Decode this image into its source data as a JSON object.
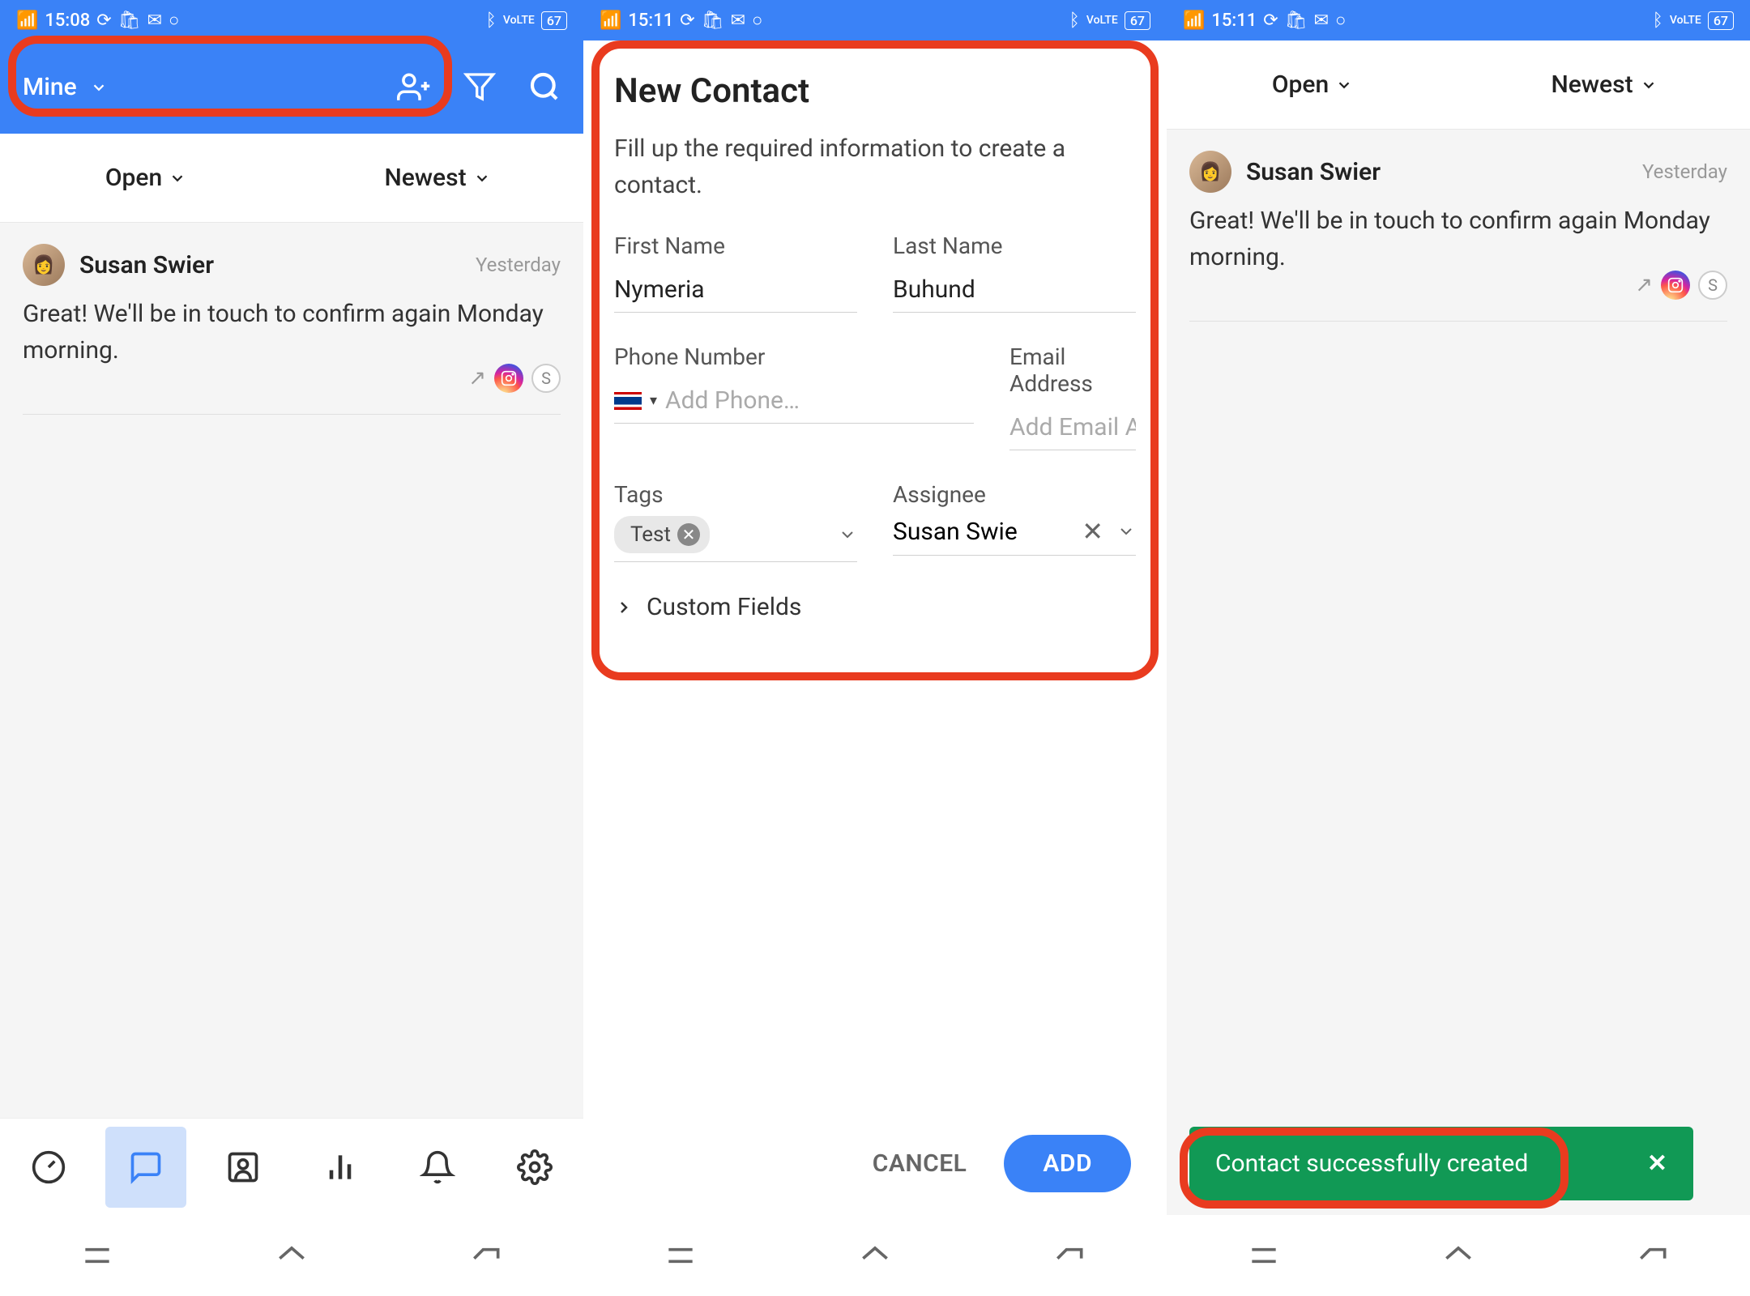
{
  "screens": [
    {
      "status": {
        "time": "15:08",
        "signal": "4G",
        "battery": "67"
      },
      "topbar": {
        "filter_label": "Mine"
      },
      "filters": {
        "open": "Open",
        "newest": "Newest"
      },
      "conversation": {
        "name": "Susan Swier",
        "time": "Yesterday",
        "message": "Great! We'll be in touch to confirm again Monday morning.",
        "badge_letter": "S"
      },
      "tabs": [
        "speedometer",
        "chat",
        "contact",
        "stats",
        "bell",
        "gear"
      ]
    },
    {
      "status": {
        "time": "15:11",
        "signal": "4G",
        "battery": "67"
      },
      "modal": {
        "title": "New Contact",
        "description": "Fill up the required information to create a contact.",
        "first_name_label": "First Name",
        "first_name_value": "Nymeria",
        "last_name_label": "Last Name",
        "last_name_value": "Buhund",
        "phone_label": "Phone Number",
        "phone_placeholder": "Add Phone…",
        "email_label": "Email Address",
        "email_placeholder": "Add Email Address",
        "tags_label": "Tags",
        "tag_value": "Test",
        "assignee_label": "Assignee",
        "assignee_value": "Susan Swie",
        "custom_fields": "Custom Fields",
        "cancel": "CANCEL",
        "add": "ADD"
      }
    },
    {
      "status": {
        "time": "15:11",
        "signal": "4G",
        "battery": "67"
      },
      "filters": {
        "open": "Open",
        "newest": "Newest"
      },
      "conversation": {
        "name": "Susan Swier",
        "time": "Yesterday",
        "message": "Great! We'll be in touch to confirm again Monday morning.",
        "badge_letter": "S"
      },
      "toast": "Contact successfully created"
    }
  ]
}
